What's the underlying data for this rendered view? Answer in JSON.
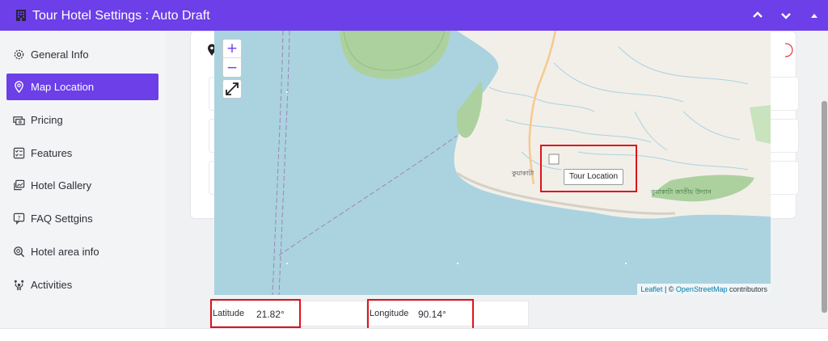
{
  "window": {
    "title": "Tour Hotel Settings : Auto Draft",
    "icons": [
      "hotel-icon",
      "chevron-up-icon",
      "chevron-down-icon",
      "caret-up-icon"
    ]
  },
  "sidebar": {
    "items": [
      {
        "label": "General Info",
        "icon": "gear-icon"
      },
      {
        "label": "Map Location",
        "icon": "map-pin-icon",
        "active": true
      },
      {
        "label": "Pricing",
        "icon": "money-stack-icon"
      },
      {
        "label": "Features",
        "icon": "checklist-icon"
      },
      {
        "label": "Hotel Gallery",
        "icon": "gallery-icon"
      },
      {
        "label": "FAQ Settgins",
        "icon": "faq-chat-icon"
      },
      {
        "label": "Hotel area info",
        "icon": "area-search-icon"
      },
      {
        "label": "Activities",
        "icon": "activities-icon"
      }
    ]
  },
  "map": {
    "zoom_in": "+",
    "zoom_out": "−",
    "marker_tooltip": "Tour Location",
    "attribution_leaflet": "Leaflet",
    "attribution_sep": " | © ",
    "attribution_osm": "OpenStreetMap",
    "attribution_suffix": " contributors",
    "labels": {
      "kuakata": "কুয়াকাটা",
      "park": "কুয়াকাটা জাতীয় উদ্যান"
    }
  },
  "coords": {
    "latitude_label": "Latitude",
    "latitude_value": "21.82°",
    "longitude_label": "Longitude",
    "longitude_value": "90.14°"
  },
  "colors": {
    "accent": "#6c3fe8",
    "highlight": "#e0131a",
    "water": "#aad3df",
    "land": "#f2efe9"
  }
}
